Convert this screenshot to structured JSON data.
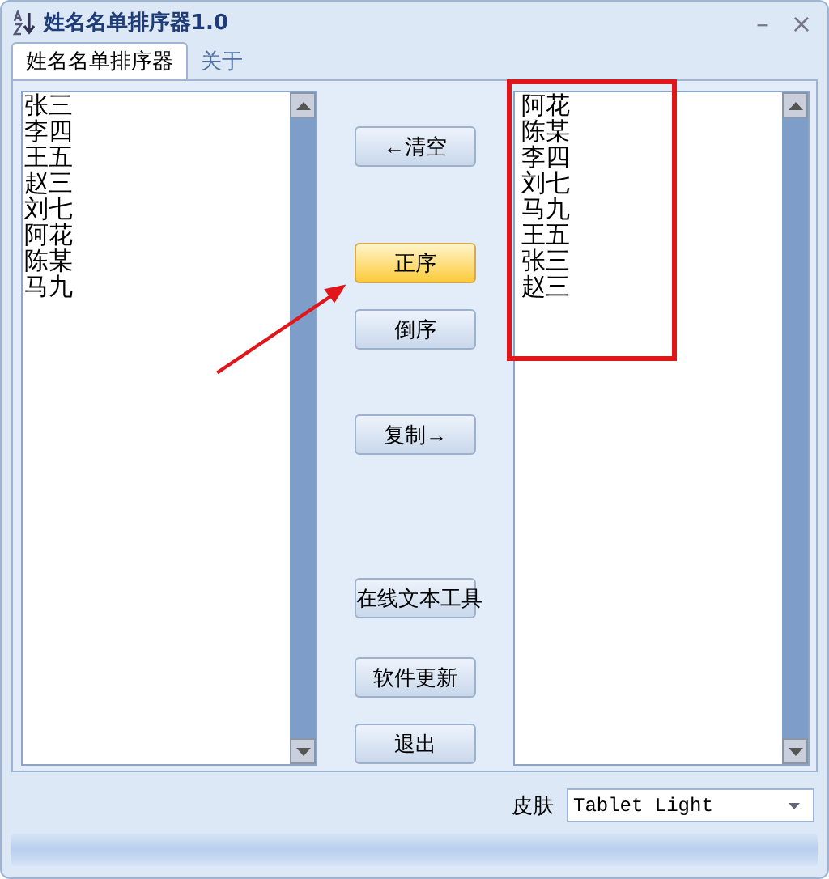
{
  "window": {
    "title": "姓名名单排序器1.0",
    "minimize": "–",
    "close": "×"
  },
  "tabs": [
    {
      "label": "姓名名单排序器",
      "selected": true
    },
    {
      "label": "关于",
      "selected": false
    }
  ],
  "input_list": [
    "张三",
    "李四",
    "王五",
    "赵三",
    "刘七",
    "阿花",
    "陈某",
    "马九"
  ],
  "output_list": [
    "阿花",
    "陈某",
    "李四",
    "刘七",
    "马九",
    "王五",
    "张三",
    "赵三"
  ],
  "buttons": [
    {
      "label": "←清空",
      "highlighted": false
    },
    {
      "label": "正序",
      "highlighted": true
    },
    {
      "label": "倒序",
      "highlighted": false
    },
    {
      "label": "复制→",
      "highlighted": false
    },
    {
      "label": "在线文本工具",
      "highlighted": false
    },
    {
      "label": "软件更新",
      "highlighted": false
    },
    {
      "label": "退出",
      "highlighted": false
    }
  ],
  "skin": {
    "label": "皮肤",
    "value": "Tablet Light"
  }
}
